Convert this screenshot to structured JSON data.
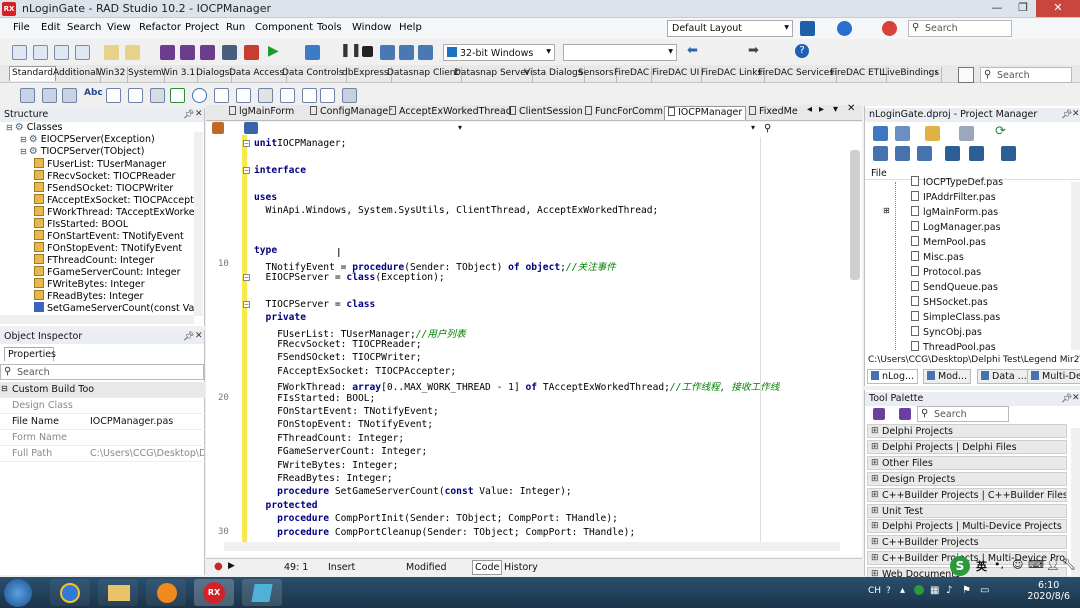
{
  "window": {
    "title": "nLoginGate - RAD Studio 10.2 - IOCPManager",
    "app_icon": "RX"
  },
  "menu": [
    "File",
    "Edit",
    "Search",
    "View",
    "Refactor",
    "Project",
    "Run",
    "Component",
    "Tools",
    "Window",
    "Help"
  ],
  "layout_combo": "Default Layout",
  "search_placeholder": "Search",
  "platform_combo": "32-bit Windows",
  "palette_tabs": [
    "Standard",
    "Additional",
    "Win32",
    "System",
    "Win 3.1",
    "Dialogs",
    "Data Access",
    "Data Controls",
    "dbExpress",
    "Datasnap Client",
    "Datasnap Server",
    "Vista Dialogs",
    "Sensors",
    "FireDAC",
    "FireDAC UI",
    "FireDAC Links",
    "FireDAC Services",
    "FireDAC ETL",
    "LiveBindings"
  ],
  "palette_search": "Search",
  "structure": {
    "title": "Structure",
    "rows": [
      {
        "text": "Classes",
        "indent": 0,
        "icon": "folder"
      },
      {
        "text": "EIOCPServer(Exception)",
        "indent": 1,
        "icon": "class"
      },
      {
        "text": "TIOCPServer(TObject)",
        "indent": 1,
        "icon": "class"
      },
      {
        "text": "FUserList: TUserManager",
        "indent": 2,
        "icon": "field"
      },
      {
        "text": "FRecvSocket: TIOCPReader",
        "indent": 2,
        "icon": "field"
      },
      {
        "text": "FSendSOcket: TIOCPWriter",
        "indent": 2,
        "icon": "field"
      },
      {
        "text": "FAcceptExSocket: TIOCPAccepte",
        "indent": 2,
        "icon": "field"
      },
      {
        "text": "FWorkThread: TAcceptExWorke",
        "indent": 2,
        "icon": "field"
      },
      {
        "text": "FIsStarted: BOOL",
        "indent": 2,
        "icon": "field"
      },
      {
        "text": "FOnStartEvent: TNotifyEvent",
        "indent": 2,
        "icon": "field"
      },
      {
        "text": "FOnStopEvent: TNotifyEvent",
        "indent": 2,
        "icon": "field"
      },
      {
        "text": "FThreadCount: Integer",
        "indent": 2,
        "icon": "field"
      },
      {
        "text": "FGameServerCount: Integer",
        "indent": 2,
        "icon": "field"
      },
      {
        "text": "FWriteBytes: Integer",
        "indent": 2,
        "icon": "field"
      },
      {
        "text": "FReadBytes: Integer",
        "indent": 2,
        "icon": "field"
      },
      {
        "text": "SetGameServerCount(const Valu",
        "indent": 2,
        "icon": "method"
      }
    ]
  },
  "object_inspector": {
    "title": "Object Inspector",
    "tab": "Properties",
    "search": "Search",
    "rows": [
      {
        "k": "Custom Build Too",
        "v": "",
        "dark": true,
        "header": true
      },
      {
        "k": "Design Class",
        "v": "",
        "dark": false
      },
      {
        "k": "File Name",
        "v": "IOCPManager.pas",
        "dark": true
      },
      {
        "k": "Form Name",
        "v": "",
        "dark": false
      },
      {
        "k": "Full Path",
        "v": "C:\\Users\\CCG\\Desktop\\Delphi",
        "dark": false
      }
    ]
  },
  "editor_tabs": [
    "lgMainForm",
    "ConfigManager",
    "AcceptExWorkedThread",
    "ClientSession",
    "FuncForComm",
    "IOCPManager",
    "FixedMe"
  ],
  "active_editor_tab": "IOCPManager",
  "code": [
    {
      "n": "",
      "t": [
        [
          "kw",
          "unit"
        ],
        [
          "",
          "IOCPManager;"
        ]
      ],
      "fold": true
    },
    {
      "n": "",
      "t": [],
      "fold": false
    },
    {
      "n": "",
      "t": [
        [
          "kw",
          "interface"
        ]
      ],
      "fold": true
    },
    {
      "n": "",
      "t": [],
      "fold": false
    },
    {
      "n": "",
      "t": [
        [
          "kw",
          "uses"
        ]
      ],
      "fold": false
    },
    {
      "n": "",
      "t": [
        [
          "",
          "  WinApi.Windows, System.SysUtils, ClientThread, AcceptExWorkedThread;"
        ]
      ],
      "fold": false
    },
    {
      "n": "",
      "t": [],
      "fold": false
    },
    {
      "n": "",
      "t": [],
      "fold": false
    },
    {
      "n": "",
      "t": [
        [
          "kw",
          "type"
        ]
      ],
      "fold": false
    },
    {
      "n": "10",
      "t": [
        [
          "",
          "  TNotifyEvent = "
        ],
        [
          "kw",
          "procedure"
        ],
        [
          "",
          "(Sender: TObject) "
        ],
        [
          "kw",
          "of object"
        ],
        [
          "",
          ";"
        ],
        [
          "cm",
          "//关注事件"
        ]
      ],
      "fold": false
    },
    {
      "n": "",
      "t": [
        [
          "",
          "  EIOCPServer = "
        ],
        [
          "kw",
          "class"
        ],
        [
          "",
          "(Exception);"
        ]
      ],
      "fold": true
    },
    {
      "n": "",
      "t": [],
      "fold": false
    },
    {
      "n": "",
      "t": [
        [
          "",
          "  TIOCPServer = "
        ],
        [
          "kw",
          "class"
        ]
      ],
      "fold": true
    },
    {
      "n": "",
      "t": [
        [
          "kw",
          "  private"
        ]
      ],
      "fold": false
    },
    {
      "n": "",
      "t": [
        [
          "",
          "    FUserList: TUserManager;"
        ],
        [
          "cm",
          "//用户列表"
        ]
      ],
      "fold": false
    },
    {
      "n": "",
      "t": [
        [
          "",
          "    FRecvSocket: TIOCPReader;"
        ]
      ],
      "fold": false
    },
    {
      "n": "",
      "t": [
        [
          "",
          "    FSendSOcket: TIOCPWriter;"
        ]
      ],
      "fold": false
    },
    {
      "n": "",
      "t": [
        [
          "",
          "    FAcceptExSocket: TIOCPAccepter;"
        ]
      ],
      "fold": false
    },
    {
      "n": "",
      "t": [
        [
          "",
          "    FWorkThread: "
        ],
        [
          "kw",
          "array"
        ],
        [
          "",
          "[0..MAX_WORK_THREAD - 1] "
        ],
        [
          "kw",
          "of"
        ],
        [
          "",
          " TAcceptExWorkedThread;"
        ],
        [
          "cm",
          "//工作线程, 接收工作线"
        ]
      ],
      "fold": false
    },
    {
      "n": "20",
      "t": [
        [
          "",
          "    FIsStarted: BOOL;"
        ]
      ],
      "fold": false
    },
    {
      "n": "",
      "t": [
        [
          "",
          "    FOnStartEvent: TNotifyEvent;"
        ]
      ],
      "fold": false
    },
    {
      "n": "",
      "t": [
        [
          "",
          "    FOnStopEvent: TNotifyEvent;"
        ]
      ],
      "fold": false
    },
    {
      "n": "",
      "t": [
        [
          "",
          "    FThreadCount: Integer;"
        ]
      ],
      "fold": false
    },
    {
      "n": "",
      "t": [
        [
          "",
          "    FGameServerCount: Integer;"
        ]
      ],
      "fold": false
    },
    {
      "n": "",
      "t": [
        [
          "",
          "    FWriteBytes: Integer;"
        ]
      ],
      "fold": false
    },
    {
      "n": "",
      "t": [
        [
          "",
          "    FReadBytes: Integer;"
        ]
      ],
      "fold": false
    },
    {
      "n": "",
      "t": [
        [
          "kw",
          "    procedure"
        ],
        [
          "",
          " SetGameServerCount("
        ],
        [
          "kw",
          "const"
        ],
        [
          "",
          " Value: Integer);"
        ]
      ],
      "fold": false
    },
    {
      "n": "",
      "t": [
        [
          "kw",
          "  protected"
        ]
      ],
      "fold": false
    },
    {
      "n": "",
      "t": [
        [
          "kw",
          "    procedure"
        ],
        [
          "",
          " CompPortInit(Sender: TObject; CompPort: THandle);"
        ]
      ],
      "fold": false
    },
    {
      "n": "30",
      "t": [
        [
          "kw",
          "    procedure"
        ],
        [
          "",
          " CompPortCleanup(Sender: TObject; CompPort: THandle);"
        ]
      ],
      "fold": false
    }
  ],
  "status": {
    "pos": "49:  1",
    "mode": "Insert",
    "state": "Modified",
    "tab_code": "Code",
    "tab_history": "History"
  },
  "project_manager": {
    "title": "nLoginGate.dproj - Project Manager",
    "column": "File",
    "files": [
      "IOCPTypeDef.pas",
      "IPAddrFilter.pas",
      "lgMainForm.pas",
      "LogManager.pas",
      "MemPool.pas",
      "Misc.pas",
      "Protocol.pas",
      "SendQueue.pas",
      "SHSocket.pas",
      "SimpleClass.pas",
      "SyncObj.pas",
      "ThreadPool.pas"
    ],
    "path": "C:\\Users\\CCG\\Desktop\\Delphi Test\\Legend Mir2\\Lo",
    "bottom_tabs": [
      "nLog...",
      "Mod...",
      "Data ...",
      "Multi-De..."
    ]
  },
  "tool_palette": {
    "title": "Tool Palette",
    "search": "Search",
    "categories": [
      "Delphi Projects",
      "Delphi Projects | Delphi Files",
      "Other Files",
      "Design Projects",
      "C++Builder Projects | C++Builder Files",
      "Unit Test",
      "Delphi Projects | Multi-Device Projects",
      "C++Builder Projects",
      "C++Builder Projects | Multi-Device Projects",
      "Web Documents"
    ]
  },
  "taskbar": {
    "ime": "英",
    "lang": "CH",
    "time": "6:10",
    "date": "2020/8/6"
  }
}
